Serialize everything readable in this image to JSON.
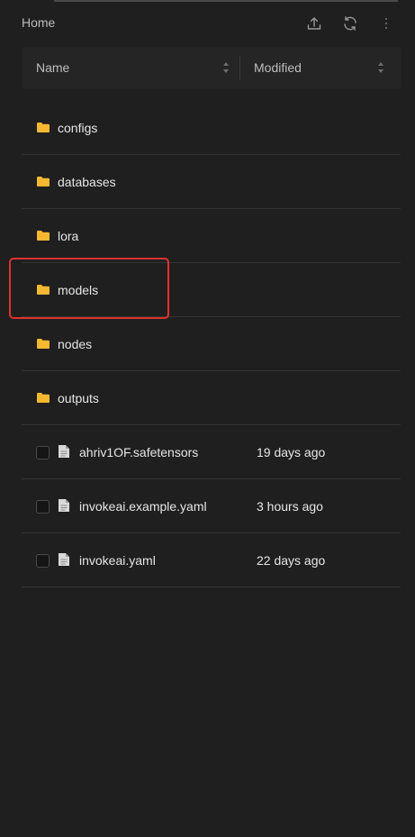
{
  "header": {
    "title": "Home",
    "actions": [
      {
        "icon": "upload-icon"
      },
      {
        "icon": "refresh-icon"
      },
      {
        "icon": "more-vertical-icon"
      }
    ]
  },
  "columns": {
    "name": "Name",
    "modified": "Modified"
  },
  "folders": [
    {
      "name": "configs"
    },
    {
      "name": "databases"
    },
    {
      "name": "lora"
    },
    {
      "name": "models"
    },
    {
      "name": "nodes"
    },
    {
      "name": "outputs"
    }
  ],
  "files": [
    {
      "name": "ahriv1OF.safetensors",
      "modified": "19 days ago"
    },
    {
      "name": "invokeai.example.yaml",
      "modified": "3 hours ago"
    },
    {
      "name": "invokeai.yaml",
      "modified": "22 days ago"
    }
  ],
  "colors": {
    "folder": "#f5b830",
    "highlight": "#e0322d",
    "background": "#1f1f1f"
  }
}
